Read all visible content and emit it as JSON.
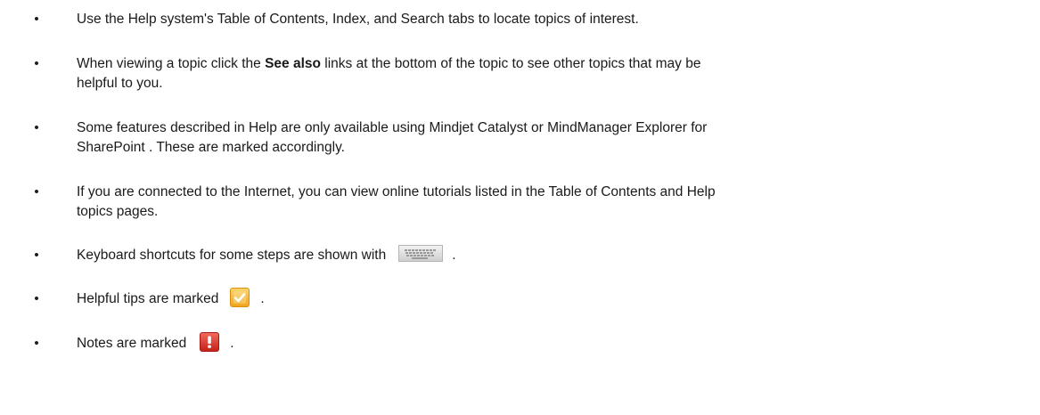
{
  "bullet_char": "•",
  "items": [
    {
      "text": "Use the Help system's Table of Contents, Index, and Search tabs to locate topics of interest."
    },
    {
      "text_before": "When viewing a topic click  the ",
      "bold": "See also",
      "text_after": " links at the bottom of the topic  to see other topics that may be",
      "text_line2": "helpful to you."
    },
    {
      "text": "Some features described in Help are only available using Mindjet Catalyst or MindManager Explorer for",
      "text_line2": "SharePoint . These are marked accordingly."
    },
    {
      "text": "If you are connected to the Internet, you can view online tutorials listed in the Table of Contents and Help",
      "text_line2": "topics pages."
    },
    {
      "text_before": "Keyboard shortcuts for some steps are shown with",
      "icon": "keyboard-icon",
      "text_after": "."
    },
    {
      "text_before": "Helpful tips are marked",
      "icon": "checkmark-tip-icon",
      "icon_color": "#f3b530",
      "text_after": "."
    },
    {
      "text_before": "Notes are marked",
      "icon": "exclamation-note-icon",
      "icon_color": "#d8342a",
      "text_after": "."
    }
  ]
}
